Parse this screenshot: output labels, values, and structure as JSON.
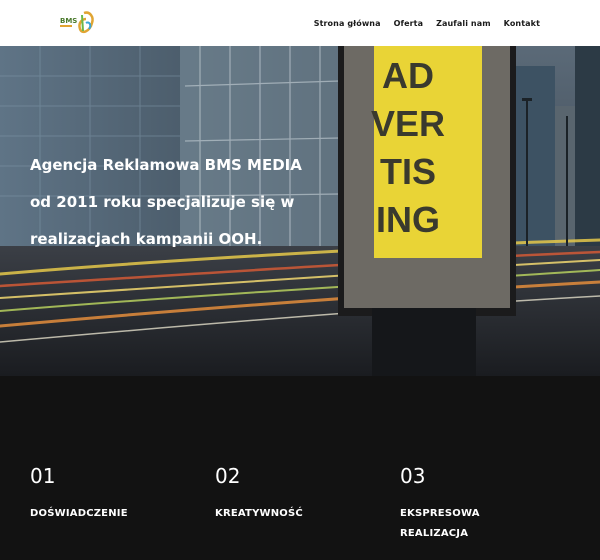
{
  "header": {
    "logo_text": "BMS",
    "nav": [
      {
        "label": "Strona główna"
      },
      {
        "label": "Oferta"
      },
      {
        "label": "Zaufali nam"
      },
      {
        "label": "Kontakt"
      }
    ]
  },
  "hero": {
    "lines": [
      "Agencja Reklamowa BMS MEDIA",
      "od 2011 roku specjalizuje się w",
      "realizacjach kampanii OOH."
    ],
    "billboard": [
      "AD",
      "VER",
      "TIS",
      "ING"
    ]
  },
  "features": [
    {
      "num": "01",
      "title": "DOŚWIADCZENIE"
    },
    {
      "num": "02",
      "title": "KREATYWNOŚĆ"
    },
    {
      "num": "03",
      "title": "EKSPRESOWA REALIZACJA"
    }
  ],
  "colors": {
    "billboard_yellow": "#e9d436",
    "header_bg": "#ffffff",
    "footer_bg": "#121212"
  }
}
